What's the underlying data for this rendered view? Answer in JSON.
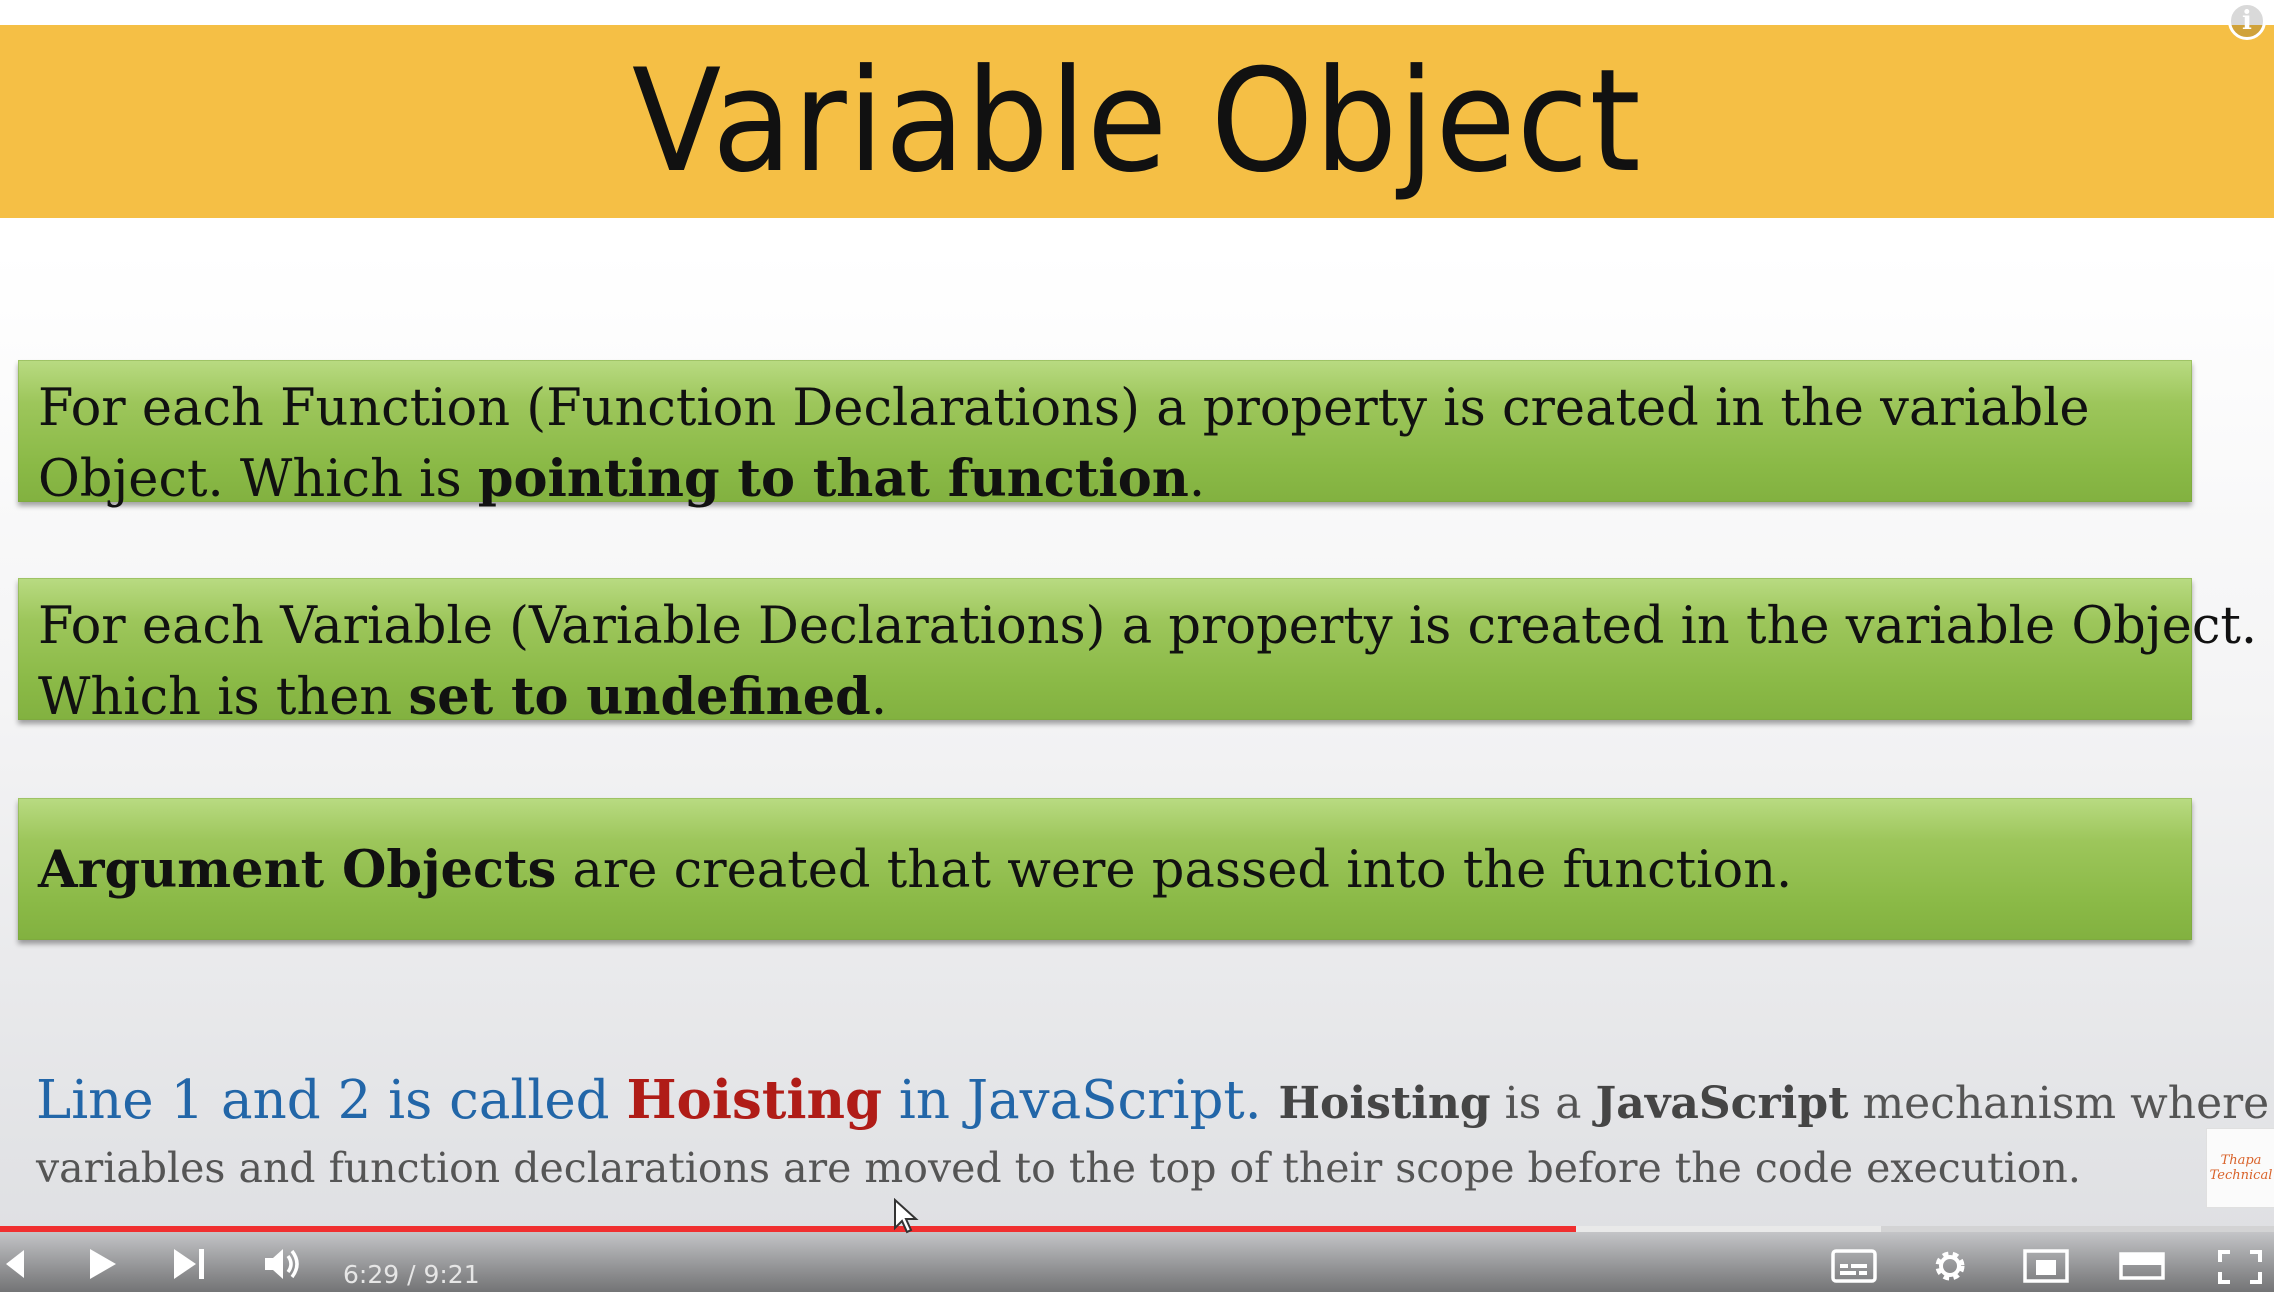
{
  "slide": {
    "title": "Variable Object",
    "box1": {
      "line1": "For each Function (Function Declarations) a property is created in the variable",
      "line2_prefix": "Object. Which is ",
      "line2_bold": "pointing to that function",
      "line2_suffix": "."
    },
    "box2": {
      "line1": "For each Variable (Variable Declarations) a property is created in the variable Object.",
      "line2_prefix": "Which is then ",
      "line2_bold": "set to undefined",
      "line2_suffix": "."
    },
    "box3": {
      "bold": "Argument Objects",
      "rest": " are created that were passed into the function."
    },
    "footer": {
      "part1": "Line 1 and 2 is called ",
      "hoisting_red": "Hoisting",
      "part2": " in JavaScript.",
      "hoisting_bold": "Hoisting",
      "part3": " is a ",
      "javascript_bold": "JavaScript",
      "part4": " mechanism where",
      "line2": "variables and function declarations are moved to the top of their scope before the code execution."
    },
    "watermark": "Thapa Technical"
  },
  "player": {
    "current_time": "6:29",
    "separator": " / ",
    "duration": "9:21",
    "progress": 0.693,
    "buffered": 0.827,
    "icons": [
      "previous-icon",
      "play-icon",
      "next-icon",
      "volume-icon",
      "subtitles-icon",
      "settings-icon",
      "miniplayer-icon",
      "theater-mode-icon",
      "fullscreen-icon",
      "info-icon"
    ]
  },
  "colors": {
    "title_bar": "#f5bf45",
    "box_green": "#9dc65b",
    "footer_blue": "#2266a8",
    "footer_red": "#b01c17",
    "progress_red": "#f02f2f"
  }
}
